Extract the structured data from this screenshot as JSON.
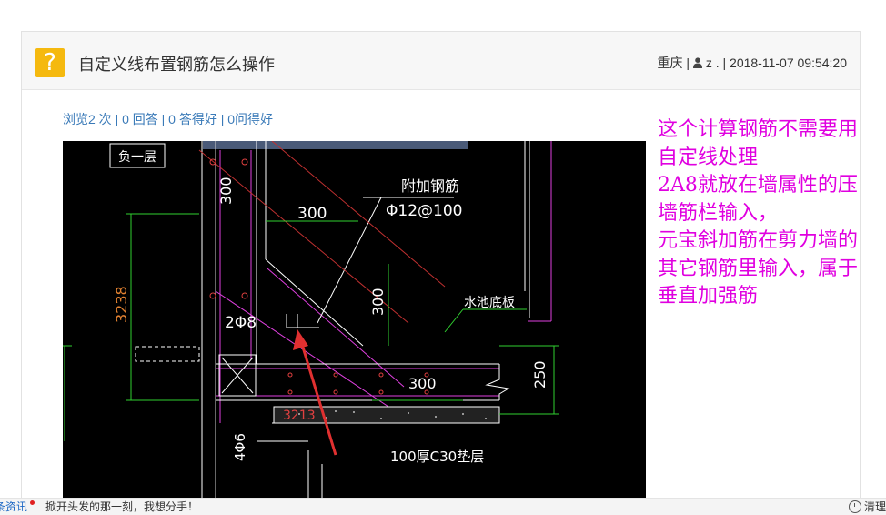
{
  "question": {
    "title": "自定义线布置钢筋怎么操作",
    "location": "重庆",
    "user": "z .",
    "datetime": "2018-11-07 09:54:20",
    "stats": "浏览2 次 | 0 回答 | 0 答得好 | 0问得好"
  },
  "image": {
    "cad_labels": {
      "floor": "负一层",
      "dim_300_top_vert": "300",
      "dim_300_horiz": "300",
      "extra_rebar": "附加钢筋",
      "rebar_spec": "Φ12@100",
      "dim_3238": "3238",
      "dim_300_mid": "300",
      "pit_bottom": "水池底板",
      "rebar_2a8": "2Φ8",
      "dim_300_low": "300",
      "dim_250": "250",
      "dim_3213": "3213",
      "rebar_4a6": "4Φ6",
      "cushion": "100厚C30垫层"
    }
  },
  "annotation": {
    "lines": [
      "这个计算钢筋不需要用",
      "自定线处理",
      "2A8就放在墙属性的压",
      "墙筋栏输入，",
      "元宝斜加筋在剪力墙的",
      "其它钢筋里输入，属于",
      "垂直加强筋"
    ],
    "color": "#e000e0"
  },
  "bottombar": {
    "news": "条资讯",
    "message": "掀开头发的那一刻，我想分手！",
    "right": "清理"
  },
  "colors": {
    "accent_icon": "#f5b90f",
    "link": "#3a7ab8"
  }
}
